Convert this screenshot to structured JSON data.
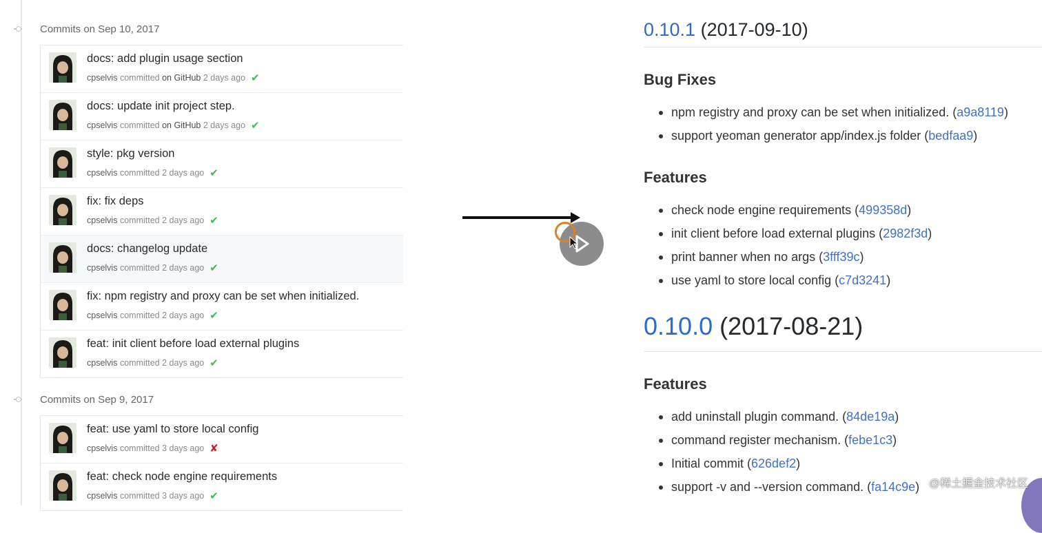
{
  "commits_panel": {
    "days": [
      {
        "header": "Commits on Sep 10, 2017",
        "commits": [
          {
            "message": "docs: add plugin usage section",
            "author": "cpselvis",
            "action": "committed",
            "via": "on GitHub",
            "time": "2 days ago",
            "status": "✔",
            "status_type": "ok"
          },
          {
            "message": "docs: update init project step.",
            "author": "cpselvis",
            "action": "committed",
            "via": "on GitHub",
            "time": "2 days ago",
            "status": "✔",
            "status_type": "ok"
          },
          {
            "message": "style: pkg version",
            "author": "cpselvis",
            "action": "committed",
            "via": "",
            "time": "2 days ago",
            "status": "✔",
            "status_type": "ok"
          },
          {
            "message": "fix: fix deps",
            "author": "cpselvis",
            "action": "committed",
            "via": "",
            "time": "2 days ago",
            "status": "✔",
            "status_type": "ok"
          },
          {
            "message": "docs: changelog update",
            "author": "cpselvis",
            "action": "committed",
            "via": "",
            "time": "2 days ago",
            "status": "✔",
            "status_type": "ok",
            "highlighted": true
          },
          {
            "message": "fix: npm registry and proxy can be set when initialized.",
            "author": "cpselvis",
            "action": "committed",
            "via": "",
            "time": "2 days ago",
            "status": "✔",
            "status_type": "ok"
          },
          {
            "message": "feat: init client before load external plugins",
            "author": "cpselvis",
            "action": "committed",
            "via": "",
            "time": "2 days ago",
            "status": "✔",
            "status_type": "ok"
          }
        ]
      },
      {
        "header": "Commits on Sep 9, 2017",
        "commits": [
          {
            "message": "feat: use yaml to store local config",
            "author": "cpselvis",
            "action": "committed",
            "via": "",
            "time": "3 days ago",
            "status": "✘",
            "status_type": "fail"
          },
          {
            "message": "feat: check node engine requirements",
            "author": "cpselvis",
            "action": "committed",
            "via": "",
            "time": "3 days ago",
            "status": "✔",
            "status_type": "ok"
          }
        ]
      }
    ]
  },
  "changelog": {
    "releases": [
      {
        "version": "0.10.1",
        "date": "(2017-09-10)",
        "sections": [
          {
            "title": "Bug Fixes",
            "items": [
              {
                "text": "npm registry and proxy can be set when initialized. (",
                "hash": "a9a8119",
                "tail": ")"
              },
              {
                "text": "support yeoman generator app/index.js folder (",
                "hash": "bedfaa9",
                "tail": ")"
              }
            ]
          },
          {
            "title": "Features",
            "items": [
              {
                "text": "check node engine requirements (",
                "hash": "499358d",
                "tail": ")"
              },
              {
                "text": "init client before load external plugins (",
                "hash": "2982f3d",
                "tail": ")"
              },
              {
                "text": "print banner when no args (",
                "hash": "3fff39c",
                "tail": ")"
              },
              {
                "text": "use yaml to store local config (",
                "hash": "c7d3241",
                "tail": ")"
              }
            ]
          }
        ]
      },
      {
        "version": "0.10.0",
        "date": "(2017-08-21)",
        "sections": [
          {
            "title": "Features",
            "items": [
              {
                "text": "add uninstall plugin command. (",
                "hash": "84de19a",
                "tail": ")"
              },
              {
                "text": "command register mechanism. (",
                "hash": "febe1c3",
                "tail": ")"
              },
              {
                "text": "Initial commit (",
                "hash": "626def2",
                "tail": ")"
              },
              {
                "text": "support -v and --version command. (",
                "hash": "fa14c9e",
                "tail": ")"
              }
            ]
          }
        ]
      }
    ]
  },
  "video_overlay": {
    "play_icon": "play-icon"
  },
  "watermark": "@稀土掘金技术社区",
  "colors": {
    "link": "#2a6bd1",
    "ok": "#3fb950",
    "fail": "#cb2431",
    "title": "#24292e"
  }
}
